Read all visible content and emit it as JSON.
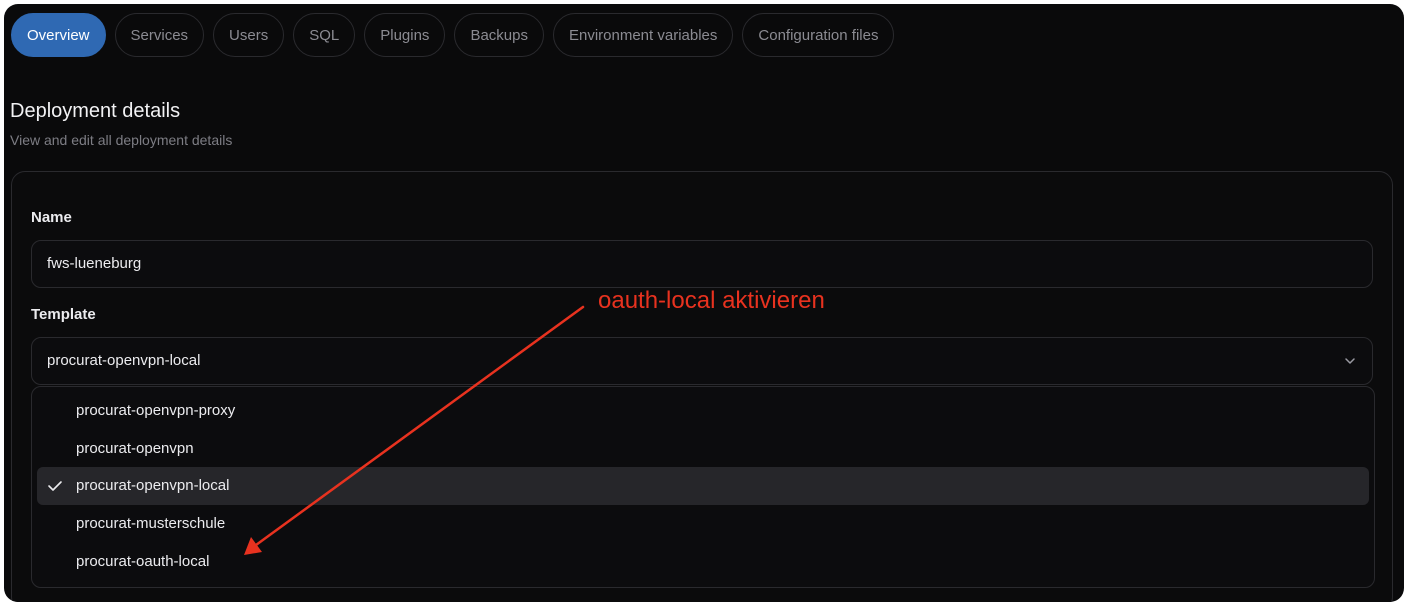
{
  "tabs": [
    {
      "label": "Overview",
      "active": true
    },
    {
      "label": "Services",
      "active": false
    },
    {
      "label": "Users",
      "active": false
    },
    {
      "label": "SQL",
      "active": false
    },
    {
      "label": "Plugins",
      "active": false
    },
    {
      "label": "Backups",
      "active": false
    },
    {
      "label": "Environment variables",
      "active": false
    },
    {
      "label": "Configuration files",
      "active": false
    }
  ],
  "section": {
    "title": "Deployment details",
    "subtitle": "View and edit all deployment details"
  },
  "form": {
    "name_label": "Name",
    "name_value": "fws-lueneburg",
    "template_label": "Template",
    "template_value": "procurat-openvpn-local",
    "options": [
      {
        "label": "procurat-openvpn-proxy",
        "selected": false
      },
      {
        "label": "procurat-openvpn",
        "selected": false
      },
      {
        "label": "procurat-openvpn-local",
        "selected": true
      },
      {
        "label": "procurat-musterschule",
        "selected": false
      },
      {
        "label": "procurat-oauth-local",
        "selected": false
      }
    ]
  },
  "annotation": {
    "text": "oauth-local aktivieren",
    "color": "#e8321f"
  },
  "colors": {
    "accent": "#2f69b3",
    "background": "#0a0a0b"
  },
  "icons": {
    "chevron": "chevron-down-icon",
    "check": "check-icon",
    "arrow": "annotation-arrow"
  }
}
